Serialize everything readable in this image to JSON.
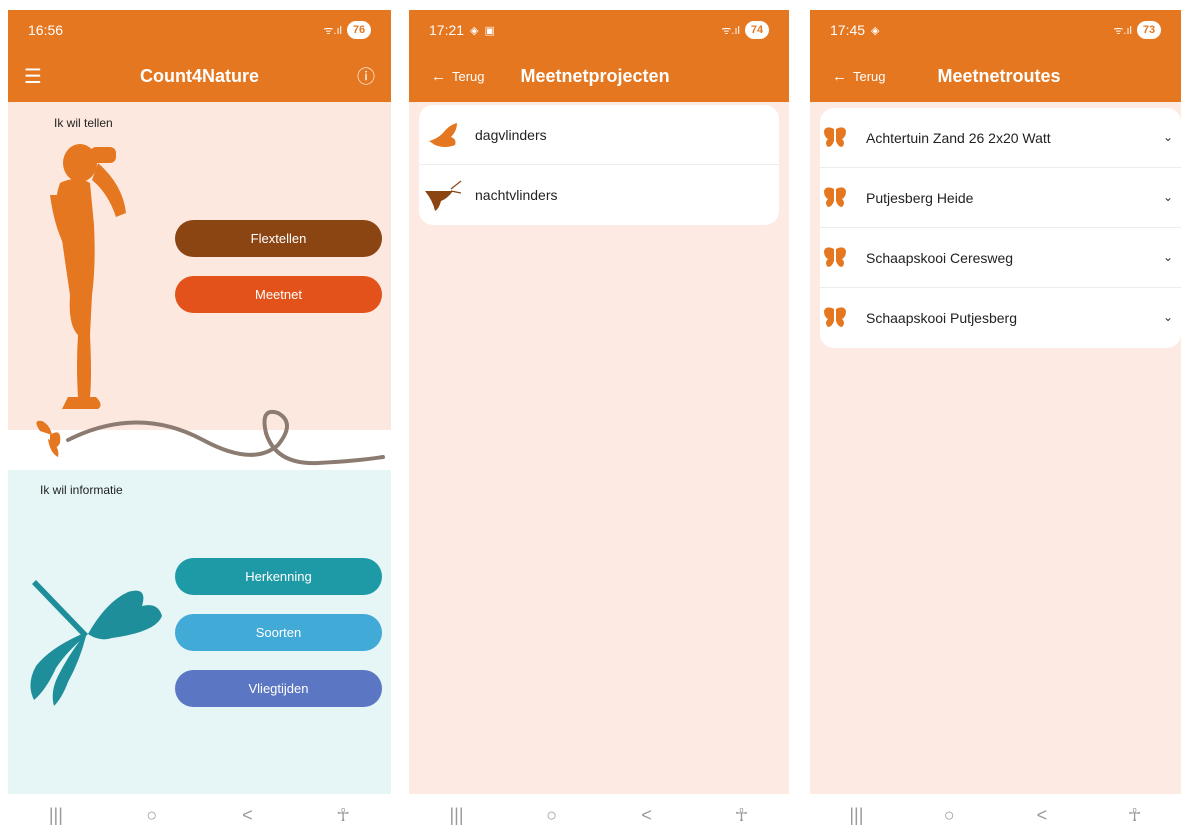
{
  "screen1": {
    "status": {
      "time": "16:56",
      "battery": "76",
      "signal": "ᯤ.ıl"
    },
    "title": "Count4Nature",
    "menu_icon": "☰",
    "info_icon": "ⓘ",
    "count_label": "Ik wil tellen",
    "btn_flextellen": "Flextellen",
    "btn_meetnet": "Meetnet",
    "info_label": "Ik wil informatie",
    "btn_herkenning": "Herkenning",
    "btn_soorten": "Soorten",
    "btn_vliegtijden": "Vliegtijden"
  },
  "screen2": {
    "status": {
      "time": "17:21",
      "battery": "74",
      "signal": "ᯤ.ıl"
    },
    "back": "Terug",
    "title": "Meetnetprojecten",
    "items": [
      "dagvlinders",
      "nachtvlinders"
    ]
  },
  "screen3": {
    "status": {
      "time": "17:45",
      "battery": "73",
      "signal": "ᯤ.ıl"
    },
    "back": "Terug",
    "title": "Meetnetroutes",
    "routes": [
      "Achtertuin Zand 26 2x20 Watt",
      "Putjesberg Heide",
      "Schaapskooi Ceresweg",
      "Schaapskooi Putjesberg"
    ]
  },
  "navbar": {
    "recents": "|||",
    "home": "○",
    "back": "<",
    "accessibility": "☥"
  },
  "colors": {
    "orange": "#e47720",
    "brown_button": "#8b4513",
    "meetnet_button": "#e4521b",
    "teal_button": "#1e9aa6",
    "light_blue_button": "#42aad6",
    "indigo_button": "#5b76c2"
  }
}
